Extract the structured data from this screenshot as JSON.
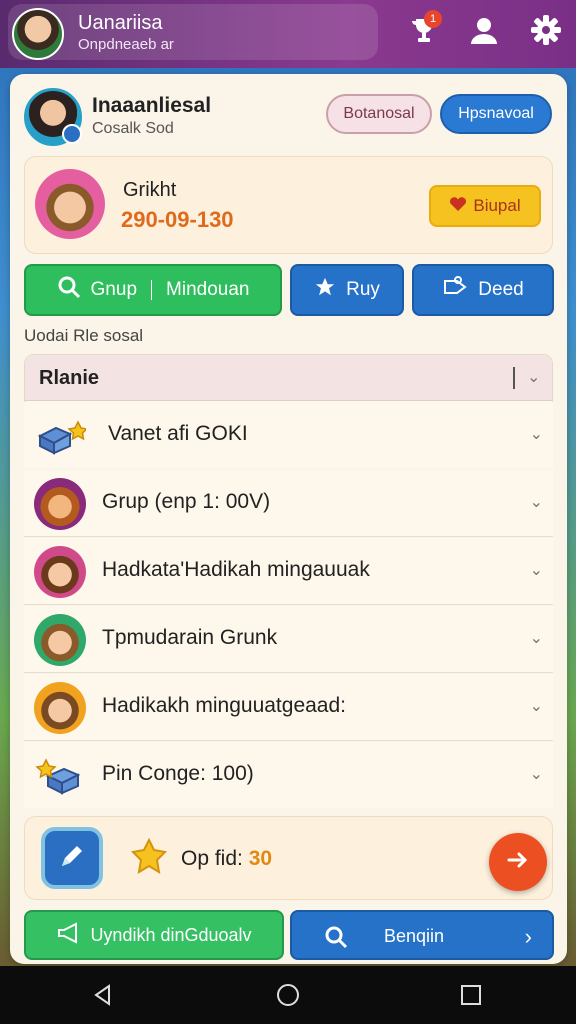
{
  "topbar": {
    "user_name": "Uanariisa",
    "user_sub": "Onpdneaeb ar",
    "notification_count": "1"
  },
  "header": {
    "title": "Inaaanliesal",
    "subtitle": "Cosalk Sod",
    "btn_outline": "Botanosal",
    "btn_blue": "Hpsnavoal"
  },
  "promo": {
    "title": "Grikht",
    "number": "290-09-130",
    "button": "Biupal"
  },
  "actions": {
    "group": "Gnup",
    "mindouan": "Mindouan",
    "ruy": "Ruy",
    "deed": "Deed"
  },
  "list_caption": "Uodai Rle sosal",
  "list": {
    "header": "Rlanie",
    "rows": [
      {
        "label": "Vanet afi GOKI",
        "icon": "star-box-icon"
      },
      {
        "label": "Grup (enp 1: 00V)",
        "icon": "character-avatar-icon"
      },
      {
        "label": "Hadkata'Hadikah mingauuak",
        "icon": "character-avatar-icon"
      },
      {
        "label": "Tpmudarain Grunk",
        "icon": "character-avatar-icon"
      },
      {
        "label": "Hadikakh minguuatgeaad:",
        "icon": "character-avatar-icon"
      },
      {
        "label": "Pin Conge: 100)",
        "icon": "star-box-icon"
      }
    ]
  },
  "footer_card": {
    "label": "Op fid:",
    "value": "30"
  },
  "bottom_buttons": {
    "green": "Uyndikh dinGduoalv",
    "blue": "Benqiin"
  },
  "colors": {
    "topbar": "#7a2f86",
    "green": "#2fbe5d",
    "blue": "#2672c9",
    "accent_orange": "#ec4f22",
    "promo_number": "#e06a1c"
  }
}
